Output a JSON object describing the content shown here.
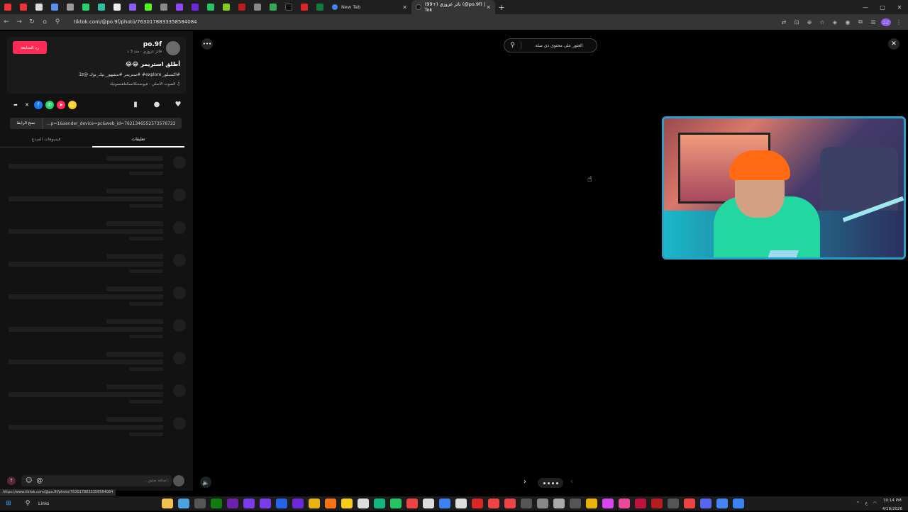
{
  "browser": {
    "tabs": [
      {
        "label": "New Tab"
      },
      {
        "label": "(99+) نائر عزوزي (@po.9f) | Tok"
      }
    ],
    "new_tab_symbol": "+",
    "url": "tiktok.com/@po.9f/photo/7630178833358584084",
    "window_controls": [
      "—",
      "▢",
      "✕"
    ]
  },
  "sidebar": {
    "follow_label": "رد المتابعة",
    "username": "po.9f",
    "subline": "فائز عزوزي · منذ 3 د",
    "caption": "أطلق استريمر 😂😂",
    "hashtags": "#اكسبلور explore# #ستريمر #مشهور_تيك_توك @3z",
    "sound": "♫ الصوت الأصلي - فيوضحكاتسكعاهنسوتيك",
    "share_icons": [
      "share-icon",
      "x-icon",
      "facebook-icon",
      "whatsapp-icon",
      "telegram-icon",
      "smile-icon"
    ],
    "copy_link_label": "نسخ الرابط",
    "link_text": "...p=1&sender_device=pc&web_id=7621346552573576722",
    "tab_comments": "تعليقات",
    "tab_creator_videos": "فيديوهات المبدع",
    "comment_placeholder": "إضافة تعليق...",
    "comment_at": "@"
  },
  "status_url": "https://www.tiktok.com/@po.9f/photo/7630178833358584084",
  "main": {
    "search_placeholder": "العثور على محتوى ذي صلة"
  },
  "taskbar": {
    "links_label": "Links",
    "time": "10:14 PM",
    "date": "4/18/2026",
    "lang": "ع"
  },
  "colors": {
    "accent": "#fe2c55",
    "webcam_border": "#2aa0c8"
  }
}
